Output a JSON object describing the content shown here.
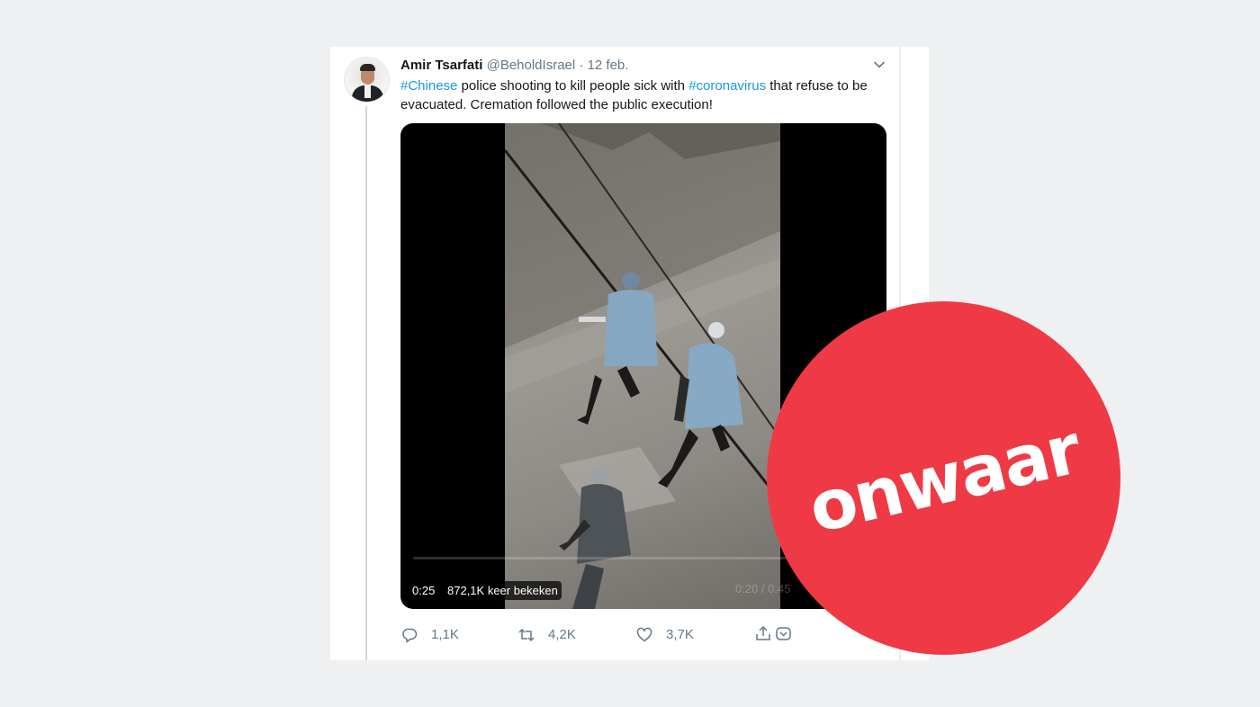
{
  "tweet": {
    "author_name": "Amir Tsarfati",
    "author_handle": "@BeholdIsrael",
    "separator": "·",
    "date": "12 feb.",
    "text_parts": {
      "hashtag_1": "#Chinese",
      "text_1": " police shooting to kill people sick with ",
      "hashtag_2": "#coronavirus",
      "text_2": " that refuse to be evacuated. Cremation followed the public execution!"
    }
  },
  "media": {
    "duration": "0:25",
    "views": "872,1K keer bekeken",
    "overlay_time": "0:20 / 0:45",
    "progress": 0.0
  },
  "actions": {
    "reply_count": "1,1K",
    "retweet_count": "4,2K",
    "like_count": "3,7K"
  },
  "stamp": {
    "label": "onwaar",
    "color": "#ef3a46"
  },
  "colors": {
    "hashtag": "#1b95e0",
    "muted": "#657786",
    "background": "#eff0f2"
  },
  "icons": [
    "chevron-down-icon",
    "reply-icon",
    "retweet-icon",
    "like-icon",
    "share-icon",
    "avatar"
  ]
}
